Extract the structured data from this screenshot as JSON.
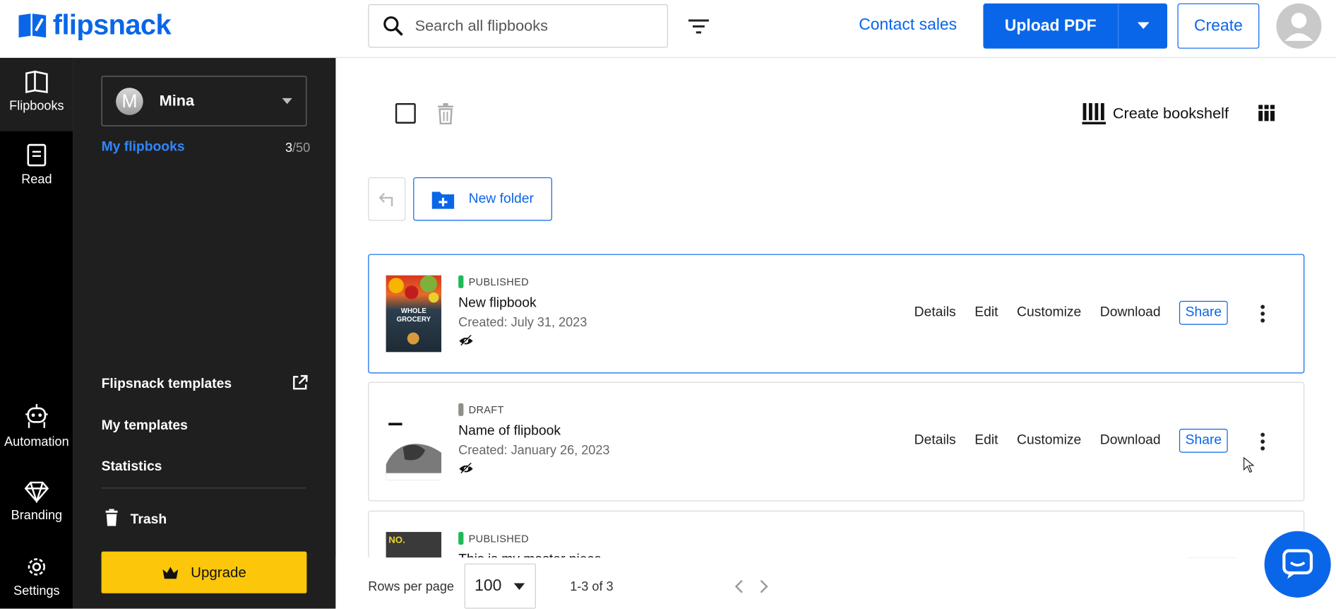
{
  "header": {
    "logo_text": "flipsnack",
    "search_placeholder": "Search all flipbooks",
    "contact_sales": "Contact sales",
    "upload_label": "Upload PDF",
    "create_label": "Create"
  },
  "rail": [
    {
      "label": "Flipbooks",
      "icon": "book-open-icon",
      "active": true
    },
    {
      "label": "Read",
      "icon": "reader-icon",
      "active": false
    },
    {
      "label": "Automation",
      "icon": "robot-icon",
      "active": false
    },
    {
      "label": "Branding",
      "icon": "diamond-icon",
      "active": false
    },
    {
      "label": "Settings",
      "icon": "gear-icon",
      "active": false
    }
  ],
  "sidebar": {
    "account_initial": "M",
    "account_name": "Mina",
    "my_flipbooks": "My flipbooks",
    "count_used": "3",
    "count_total": "/50",
    "links": {
      "templates": "Flipsnack templates",
      "my_templates": "My templates",
      "statistics": "Statistics",
      "trash": "Trash"
    },
    "upgrade": "Upgrade"
  },
  "toolbar": {
    "create_bookshelf": "Create bookshelf",
    "new_folder": "New folder"
  },
  "flipbooks": [
    {
      "status": "PUBLISHED",
      "status_color": "#1db954",
      "title": "New flipbook",
      "created": "Created: July 31, 2023"
    },
    {
      "status": "DRAFT",
      "status_color": "#8f8f88",
      "title": "Name of flipbook",
      "created": "Created: January 26, 2023"
    },
    {
      "status": "PUBLISHED",
      "status_color": "#1db954",
      "title": "This is my master piece",
      "created": ""
    }
  ],
  "actions": {
    "details": "Details",
    "edit": "Edit",
    "customize": "Customize",
    "download": "Download",
    "share": "Share"
  },
  "thumb1_text": "WHOLE GROCERY",
  "thumb3_text": "NO.",
  "pagination": {
    "rows_label": "Rows per page",
    "rows_value": "100",
    "range": "1-3 of 3"
  },
  "colors": {
    "accent": "#0a66e8",
    "upgrade": "#fcc70a",
    "rail": "#000000",
    "sidebar": "#1f1f1f"
  }
}
